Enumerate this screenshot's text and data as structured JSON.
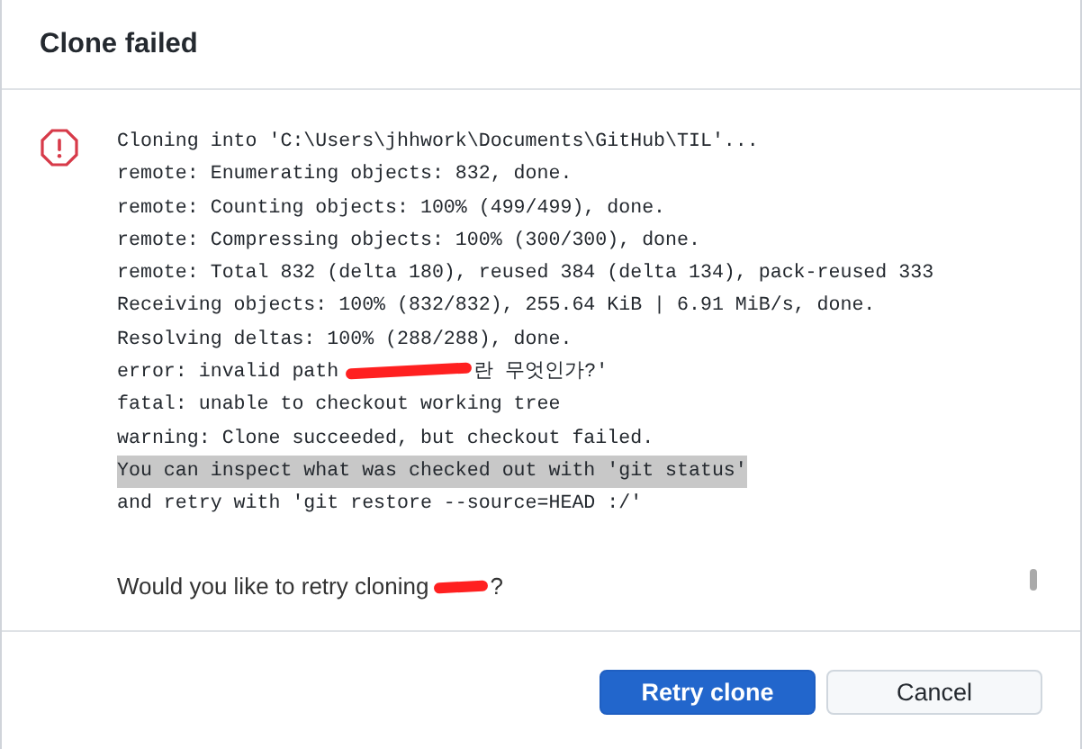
{
  "dialog": {
    "title": "Clone failed"
  },
  "log": [
    {
      "text": "Cloning into 'C:\\Users\\jhhwork\\Documents\\GitHub\\TIL'...",
      "selected": false
    },
    {
      "text": "remote: Enumerating objects: 832, done.",
      "selected": false
    },
    {
      "text": "remote: Counting objects: 100% (499/499), done.",
      "selected": false
    },
    {
      "text": "remote: Compressing objects: 100% (300/300), done.",
      "selected": false
    },
    {
      "text": "remote: Total 832 (delta 180), reused 384 (delta 134), pack-reused 333",
      "selected": false
    },
    {
      "text": "Receiving objects: 100% (832/832), 255.64 KiB | 6.91 MiB/s, done.",
      "selected": false
    },
    {
      "text": "Resolving deltas: 100% (288/288), done.",
      "selected": false
    },
    {
      "text": "error: invalid path",
      "redacted": true,
      "after": "란 무엇인가?'",
      "selected": false
    },
    {
      "text": "fatal: unable to checkout working tree",
      "selected": false
    },
    {
      "text": "warning: Clone succeeded, but checkout failed.",
      "selected": false
    },
    {
      "text": "You can inspect what was checked out with 'git status'",
      "selected": true
    },
    {
      "text": "and retry with 'git restore --source=HEAD :/'",
      "selected": false
    }
  ],
  "question": {
    "text": "Would you like to retry cloning",
    "redacted": true,
    "after": "?"
  },
  "buttons": [
    {
      "label": "Retry clone",
      "kind": "primary"
    },
    {
      "label": "Cancel",
      "kind": "secondary"
    }
  ]
}
